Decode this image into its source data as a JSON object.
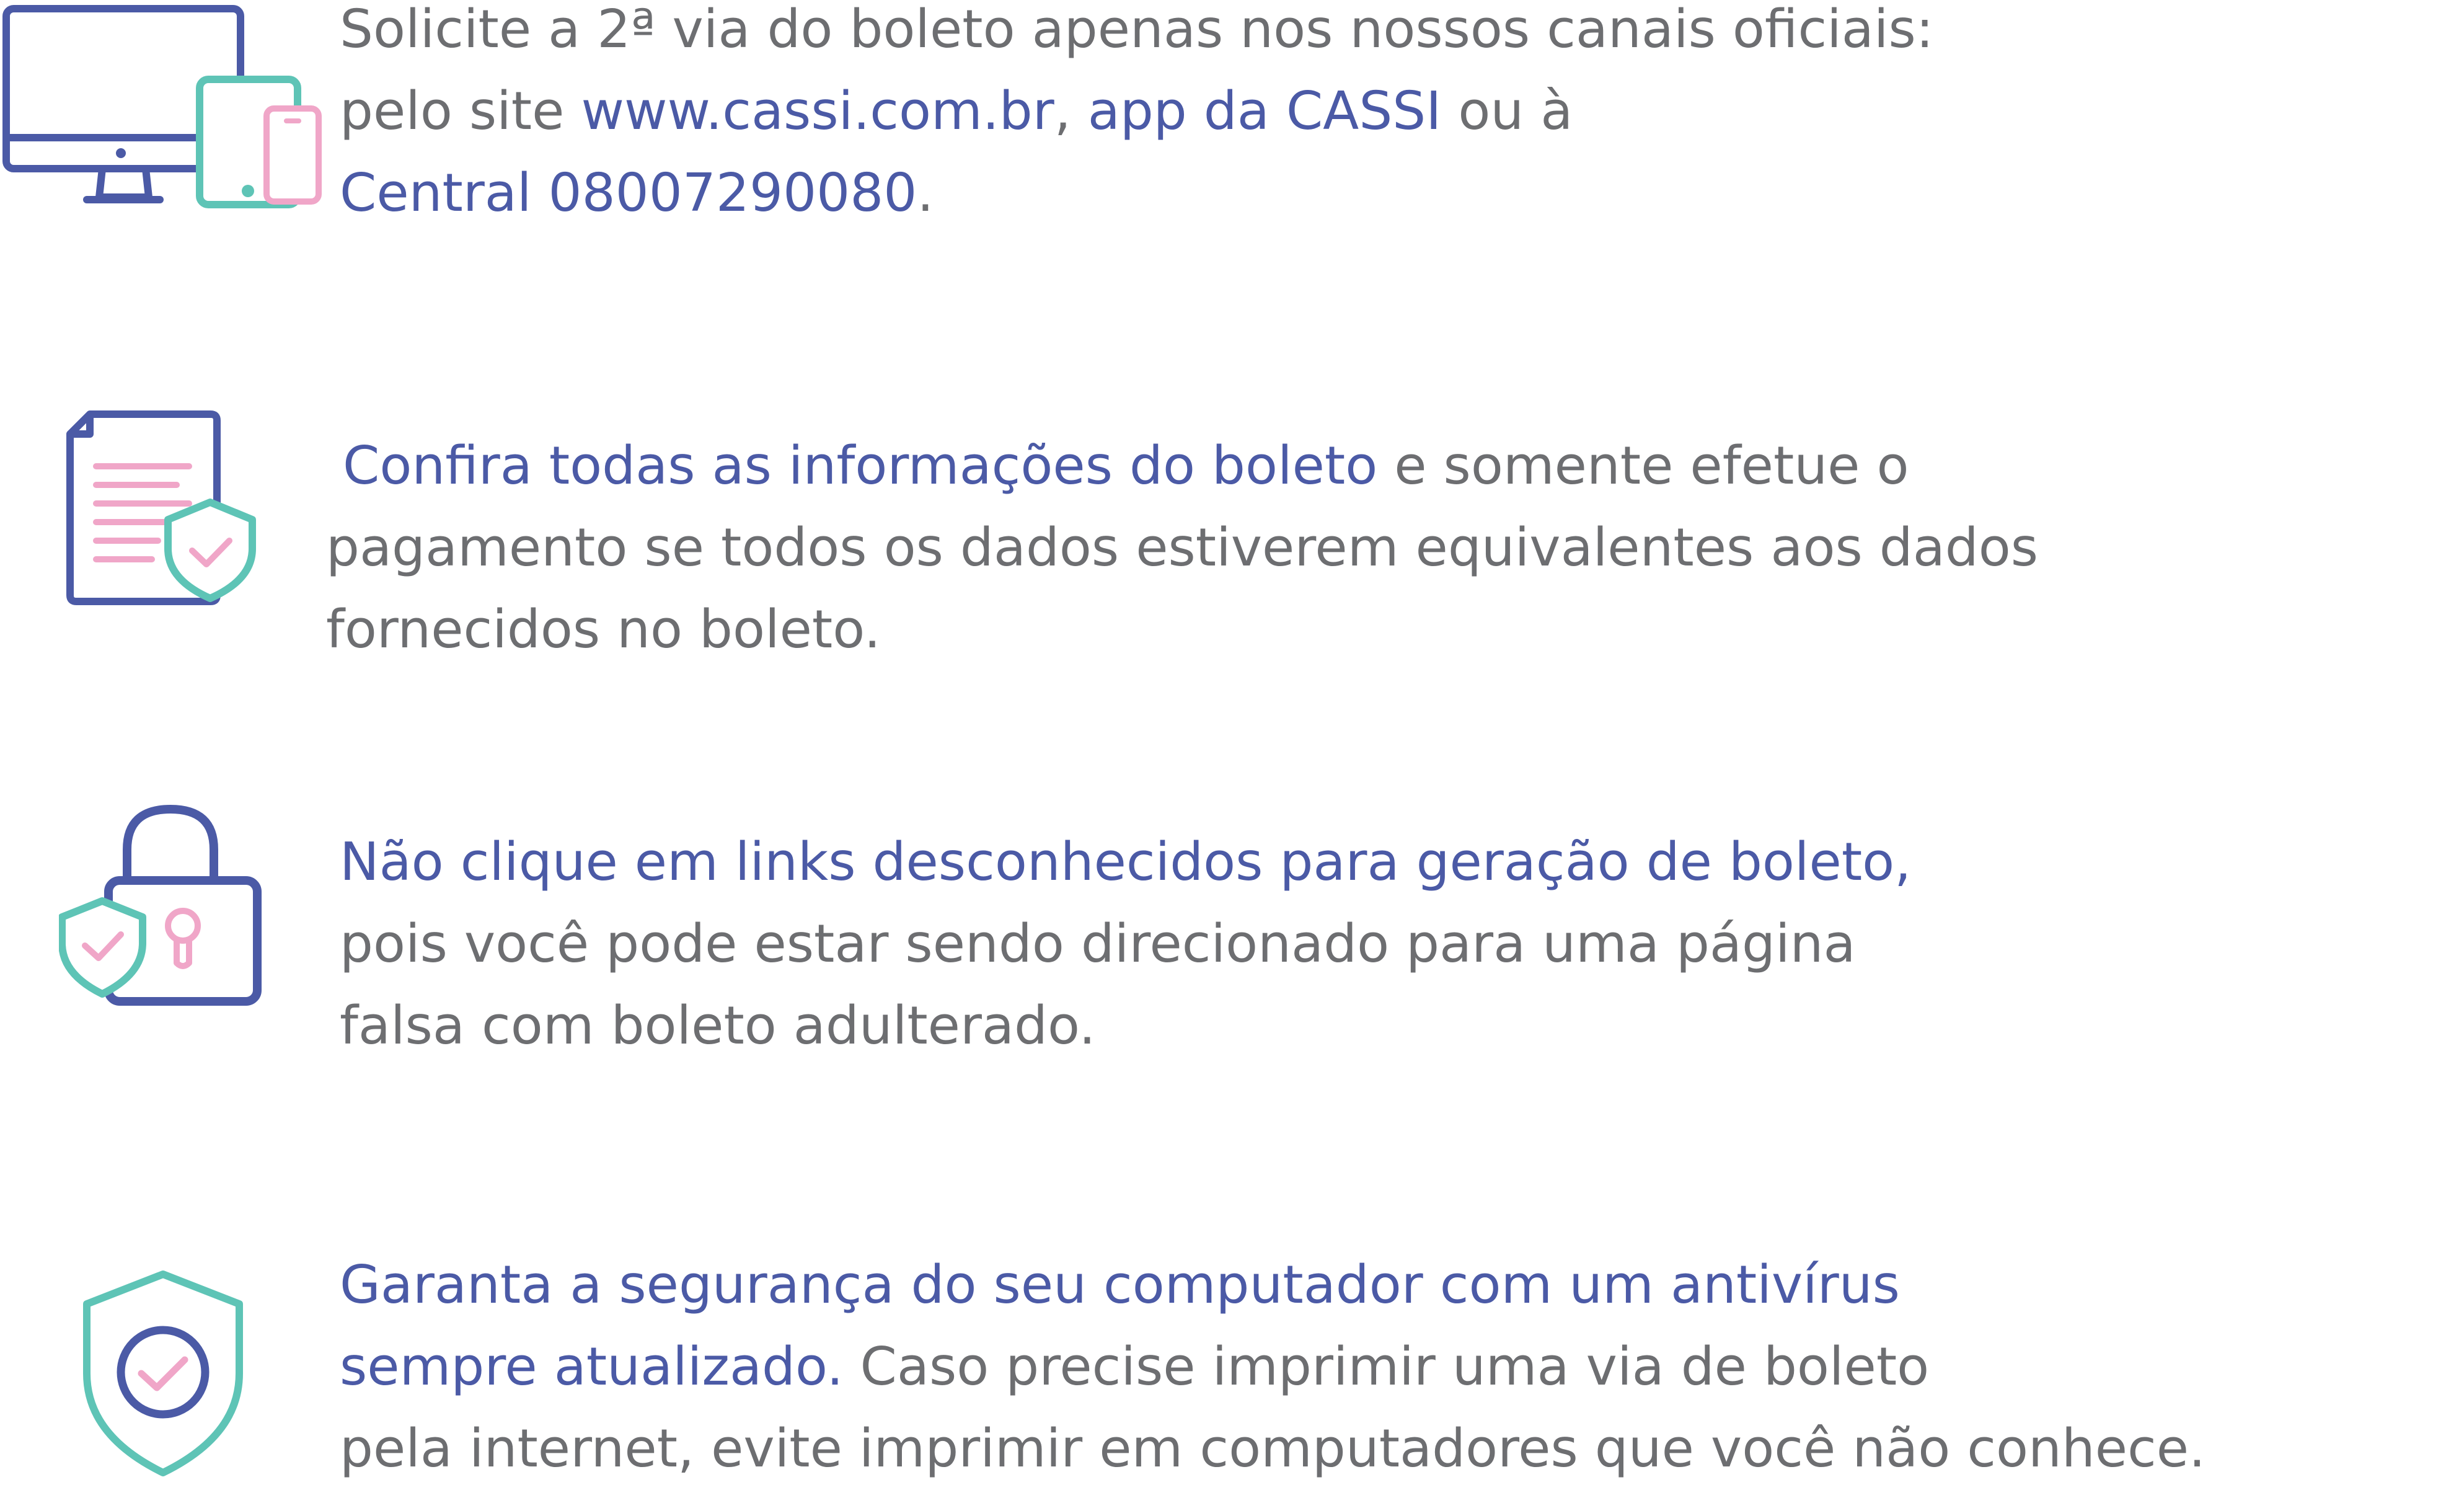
{
  "colors": {
    "text_gray": "#6d6e71",
    "highlight_blue": "#4b5aa6",
    "icon_blue": "#4b5aa6",
    "icon_teal": "#5ec4b6",
    "icon_pink": "#f0a6c8"
  },
  "items": [
    {
      "icon": "devices-icon",
      "line1": "Solicite a 2ª via do boleto apenas nos nossos canais oficiais:",
      "line2_pre": "pelo site ",
      "line2_link1": "www.cassi.com.br",
      "line2_sep": ", ",
      "line2_link2": "app da CASSI",
      "line2_post": " ou à",
      "line3_link": "Central 08007290080",
      "line3_post": "."
    },
    {
      "icon": "document-shield-icon",
      "line1_hl": "Confira todas as informações do boleto",
      "line1_post": " e somente efetue o",
      "line2": "pagamento se todos os dados estiverem equivalentes aos dados",
      "line3": "fornecidos no boleto."
    },
    {
      "icon": "padlock-shield-icon",
      "line1_hl": "Não clique em links desconhecidos para geração de boleto,",
      "line2": "pois você pode estar sendo direcionado para uma página",
      "line3": "falsa com boleto adulterado."
    },
    {
      "icon": "shield-check-icon",
      "line1_hl": "Garanta a segurança do seu computador com um antivírus",
      "line2_hl": "sempre atualizado.",
      "line2_post": " Caso precise imprimir uma via de boleto",
      "line3": "pela internet, evite imprimir em computadores que você não conhece."
    }
  ]
}
